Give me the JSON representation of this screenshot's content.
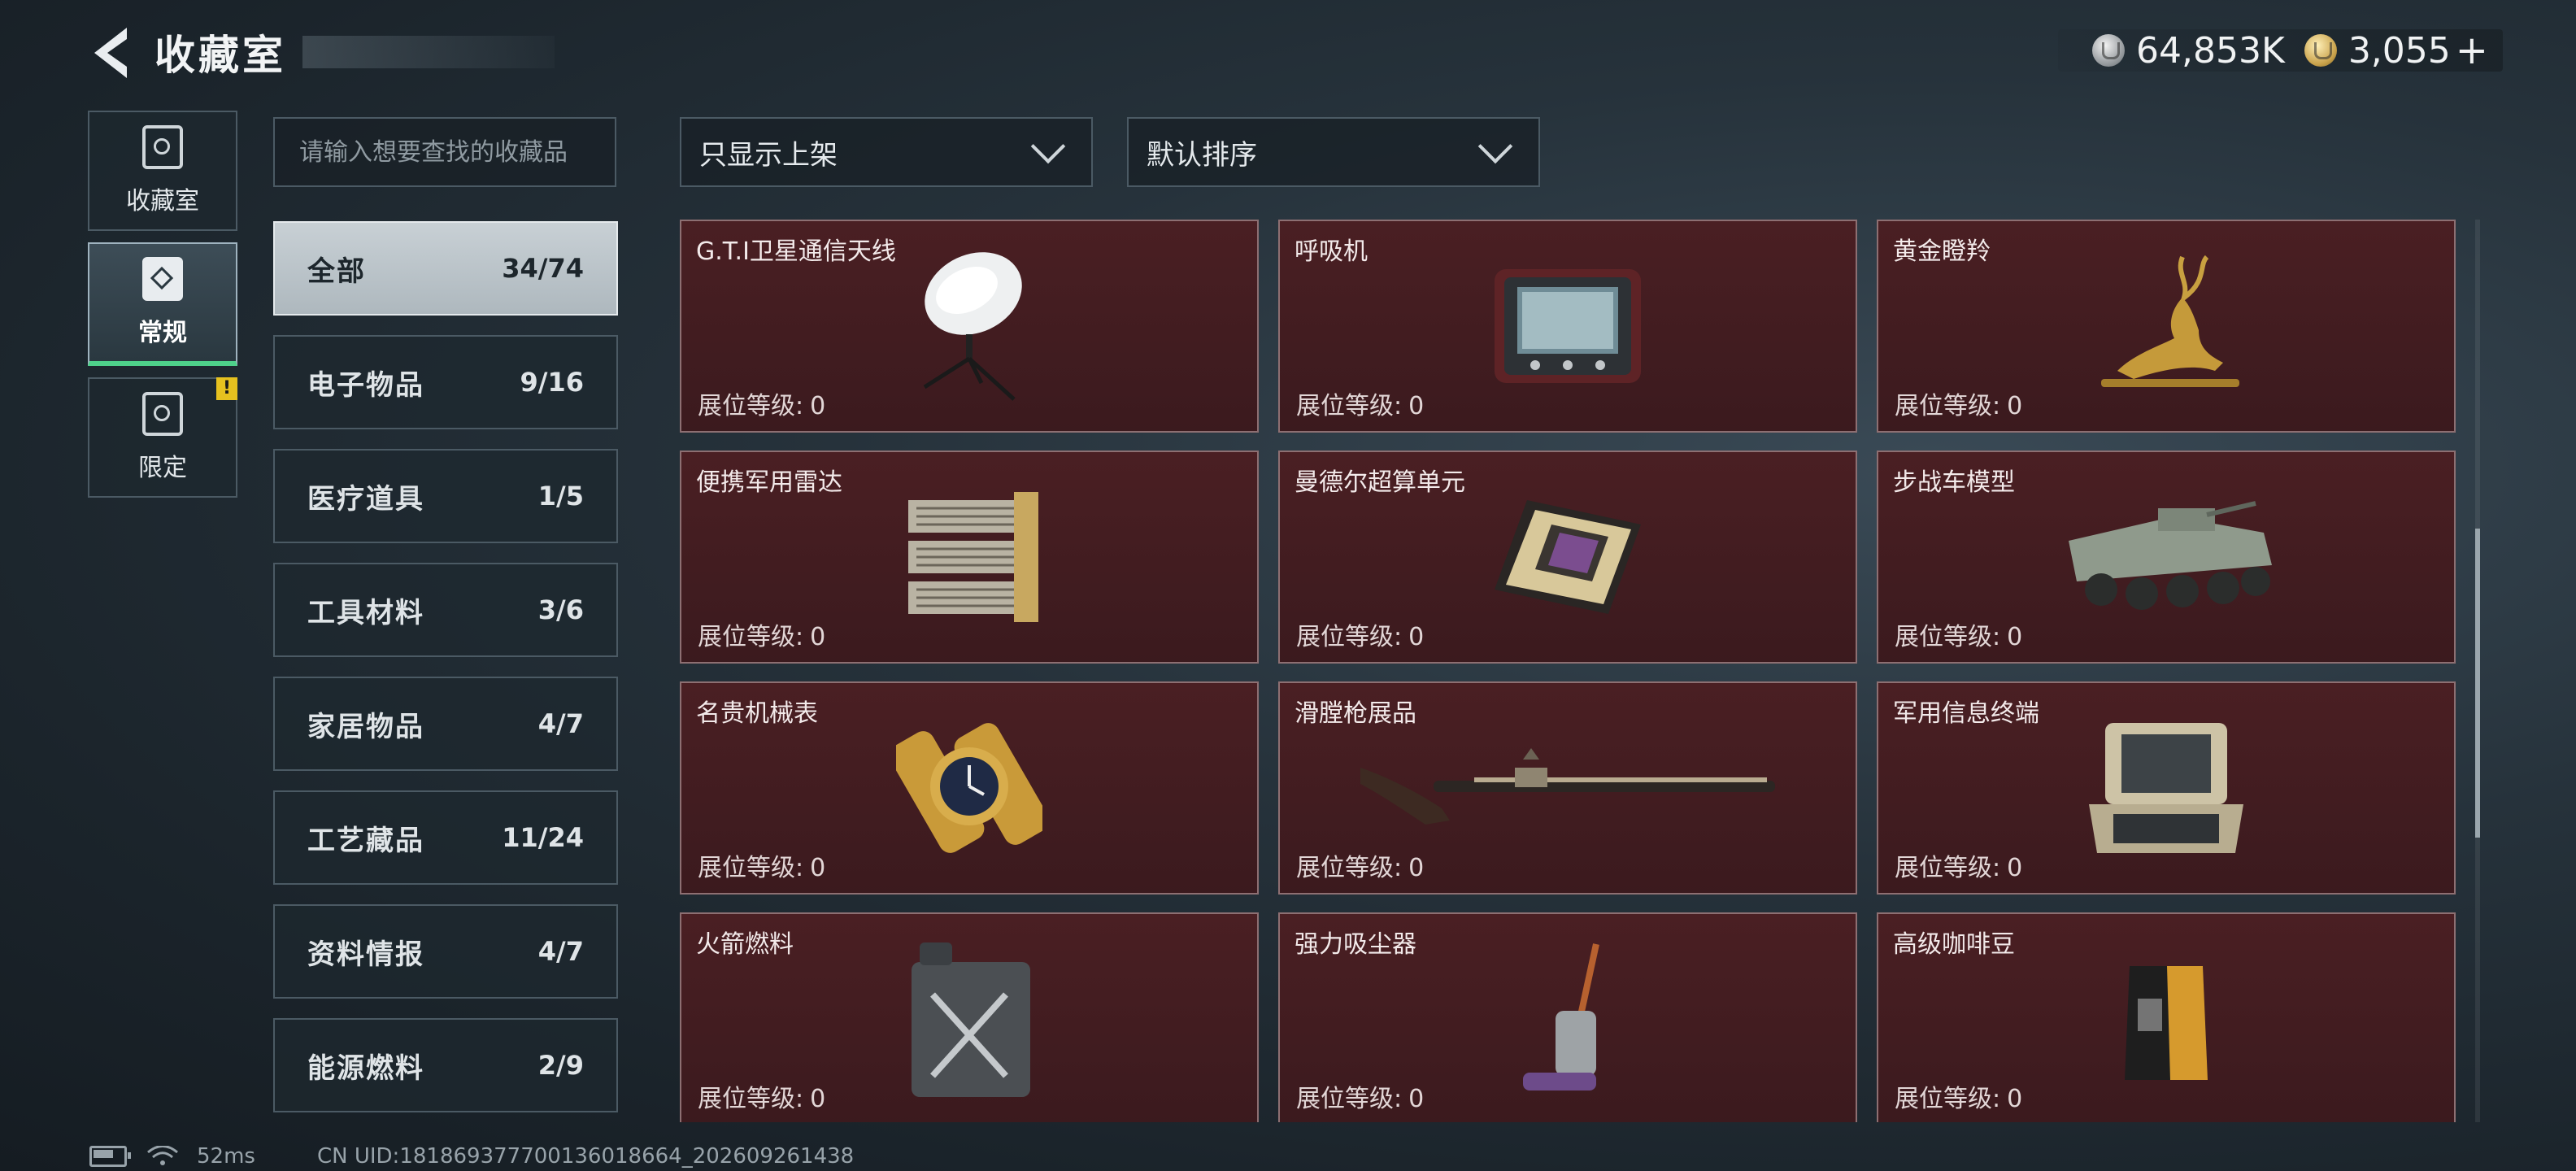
{
  "header": {
    "title": "收藏室",
    "currency": [
      {
        "icon": "silver-coin-icon",
        "value": "64,853K"
      },
      {
        "icon": "gold-coin-icon",
        "value": "3,055"
      }
    ],
    "plus_label": "+"
  },
  "side_tabs": [
    {
      "label": "收藏室",
      "icon": "collection-room-icon",
      "active": false,
      "alert": false
    },
    {
      "label": "常规",
      "icon": "regular-icon",
      "active": true,
      "alert": false
    },
    {
      "label": "限定",
      "icon": "limited-icon",
      "active": false,
      "alert": true,
      "alert_text": "!"
    }
  ],
  "search": {
    "placeholder": "请输入想要查找的收藏品",
    "value": ""
  },
  "categories": [
    {
      "name": "全部",
      "count": "34/74",
      "active": true
    },
    {
      "name": "电子物品",
      "count": "9/16"
    },
    {
      "name": "医疗道具",
      "count": "1/5"
    },
    {
      "name": "工具材料",
      "count": "3/6"
    },
    {
      "name": "家居物品",
      "count": "4/7"
    },
    {
      "name": "工艺藏品",
      "count": "11/24"
    },
    {
      "name": "资料情报",
      "count": "4/7"
    },
    {
      "name": "能源燃料",
      "count": "2/9"
    }
  ],
  "filters": {
    "display": "只显示上架",
    "sort": "默认排序"
  },
  "items": [
    {
      "name": "G.T.I卫星通信天线",
      "level_label": "展位等级:",
      "level": "0",
      "icon": "satellite-dish-icon"
    },
    {
      "name": "呼吸机",
      "level_label": "展位等级:",
      "level": "0",
      "icon": "ventilator-icon"
    },
    {
      "name": "黄金瞪羚",
      "level_label": "展位等级:",
      "level": "0",
      "icon": "golden-gazelle-icon"
    },
    {
      "name": "便携军用雷达",
      "level_label": "展位等级:",
      "level": "0",
      "icon": "portable-radar-icon"
    },
    {
      "name": "曼德尔超算单元",
      "level_label": "展位等级:",
      "level": "0",
      "icon": "supercomputer-unit-icon"
    },
    {
      "name": "步战车模型",
      "level_label": "展位等级:",
      "level": "0",
      "icon": "ifv-model-icon"
    },
    {
      "name": "名贵机械表",
      "level_label": "展位等级:",
      "level": "0",
      "icon": "mechanical-watch-icon"
    },
    {
      "name": "滑膛枪展品",
      "level_label": "展位等级:",
      "level": "0",
      "icon": "musket-icon"
    },
    {
      "name": "军用信息终端",
      "level_label": "展位等级:",
      "level": "0",
      "icon": "military-terminal-icon"
    },
    {
      "name": "火箭燃料",
      "level_label": "展位等级:",
      "level": "0",
      "icon": "fuel-canister-icon"
    },
    {
      "name": "强力吸尘器",
      "level_label": "展位等级:",
      "level": "0",
      "icon": "vacuum-cleaner-icon"
    },
    {
      "name": "高级咖啡豆",
      "level_label": "展位等级:",
      "level": "0",
      "icon": "coffee-bag-icon"
    }
  ],
  "status": {
    "ping": "52ms",
    "uid": "CN UID:18186937770013601​8664_202609261438"
  }
}
